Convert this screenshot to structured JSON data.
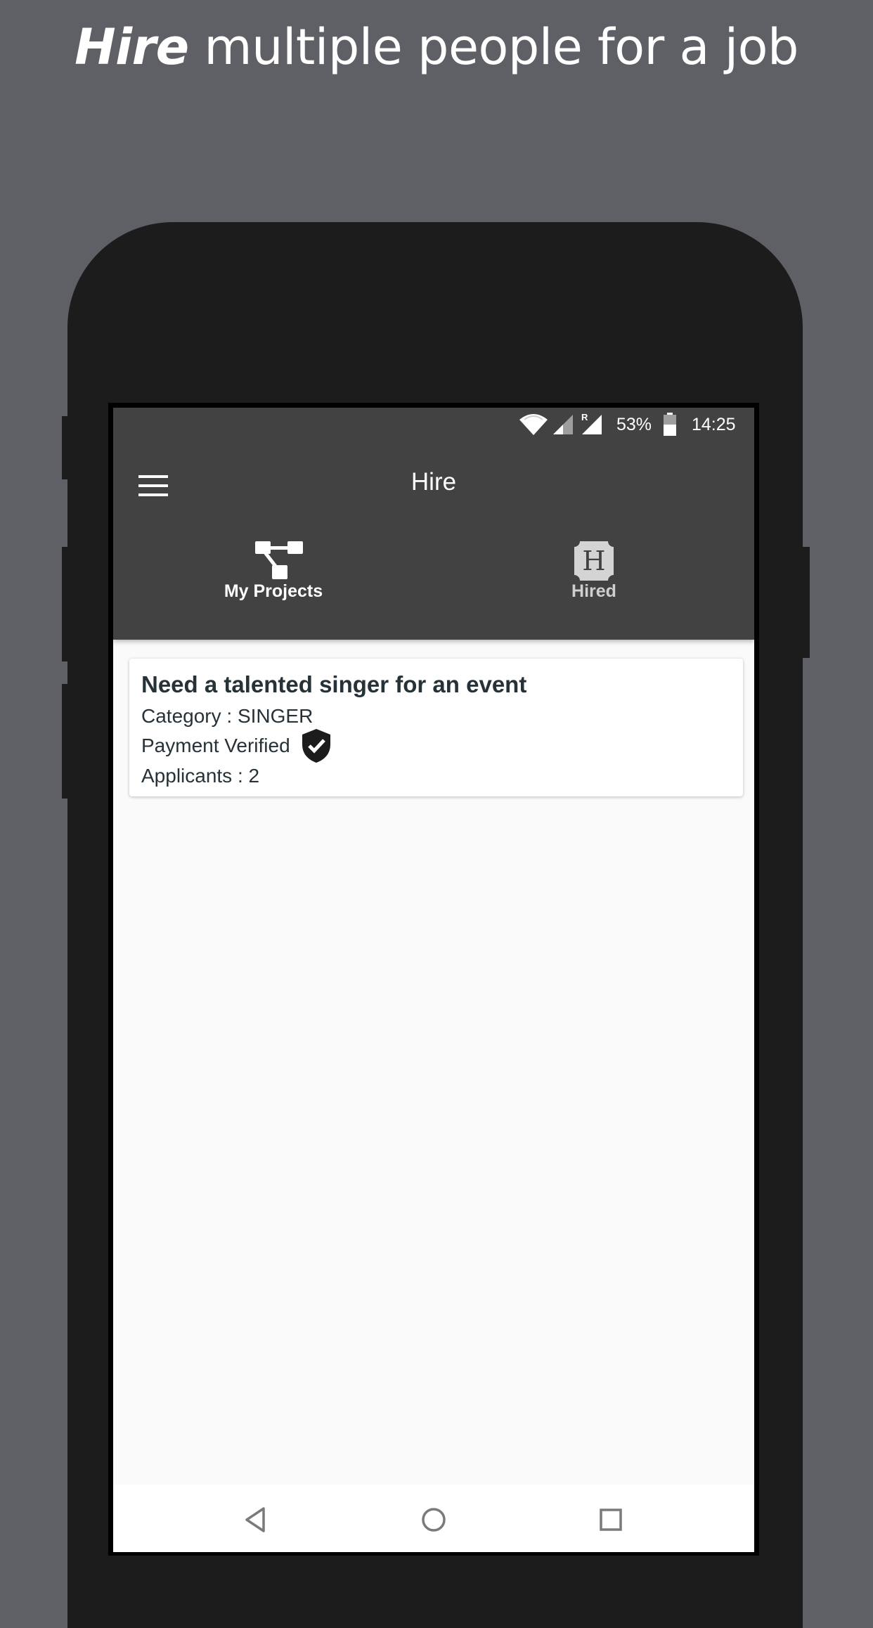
{
  "headline": {
    "bold": "Hire",
    "rest": "multiple people for a job"
  },
  "status_bar": {
    "battery": "53%",
    "time": "14:25",
    "roaming_mark": "R",
    "icons": [
      "wifi-icon",
      "signal-icon",
      "roaming-signal-icon",
      "battery-icon"
    ]
  },
  "app_bar": {
    "title": "Hire",
    "menu_icon": "menu-icon"
  },
  "tabs": [
    {
      "label": "My Projects",
      "icon": "projects-icon",
      "active": true
    },
    {
      "label": "Hired",
      "icon": "hired-badge-icon",
      "icon_text": "H",
      "active": false
    }
  ],
  "projects": [
    {
      "title": "Need a talented singer for an event",
      "category": "Category : SINGER",
      "payment": "Payment Verified",
      "payment_icon": "verified-shield-icon",
      "applicants": "Applicants : 2"
    }
  ],
  "nav_bar": {
    "buttons": [
      "back-icon",
      "home-icon",
      "recents-icon"
    ]
  },
  "colors": {
    "background": "#5f6066",
    "phone_body": "#1c1c1d",
    "app_bar": "#424242",
    "content_bg": "#fafafa",
    "card_text": "#263238",
    "inactive_tab": "#cfcfcf"
  }
}
